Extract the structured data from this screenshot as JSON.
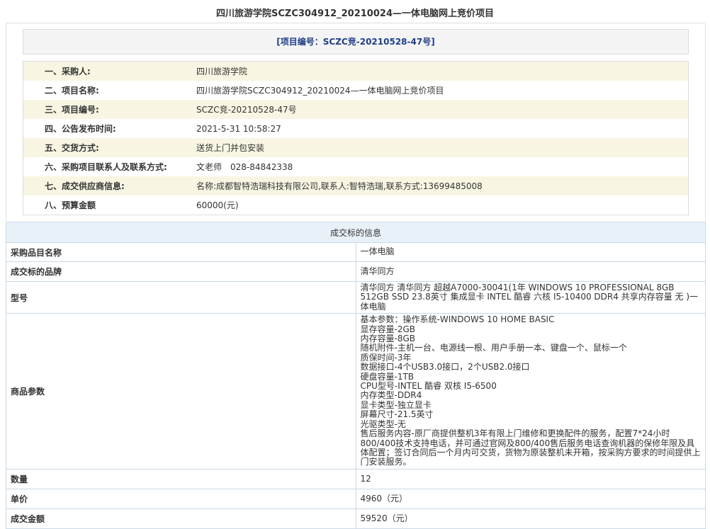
{
  "title": "四川旅游学院SCZC304912_20210024—一体电脑网上竞价项目",
  "project_no_text": "[项目编号：SCZC竞-20210528-47号]",
  "info_rows": [
    {
      "label": "一、采购人:",
      "value": "四川旅游学院"
    },
    {
      "label": "二、项目名称:",
      "value": "四川旅游学院SCZC304912_20210024—一体电脑网上竞价项目"
    },
    {
      "label": "三、项目编号:",
      "value": "SCZC竞-20210528-47号"
    },
    {
      "label": "四、公告发布时间:",
      "value": "2021-5-31 10:58:27"
    },
    {
      "label": "五、交货方式:",
      "value": "送货上门并包安装"
    },
    {
      "label": "六、采购项目联系人及联系方式:",
      "value": "文老师　028-84842338"
    },
    {
      "label": "七、成交供应商信息:",
      "value": "名称:成都智特浩瑞科技有限公司,联系人:智特浩瑞,联系方式:13699485008"
    },
    {
      "label": "八、预算金额",
      "value": "60000(元)"
    }
  ],
  "deal": {
    "header": "成交标的信息",
    "item_name_label": "采购品目名称",
    "item_name": "一体电脑",
    "brand_label": "成交标的品牌",
    "brand": "清华同方",
    "model_label": "型号",
    "model": "清华同方 清华同方 超越A7000-30041(1年 WINDOWS 10 PROFESSIONAL 8GB 512GB SSD 23.8英寸 集成显卡 INTEL 酷睿 六核 I5-10400 DDR4 共享内存容量 无 )一体电脑",
    "params_label": "商品参数",
    "params": [
      "基本参数：操作系统-WINDOWS 10 HOME BASIC",
      "显存容量-2GB",
      "内存容量-8GB",
      "随机附件-主机一台、电源线一根、用户手册一本、键盘一个、鼠标一个",
      "质保时间-3年",
      "数据接口-4个USB3.0接口，2个USB2.0接口",
      "硬盘容量-1TB",
      "CPU型号-INTEL 酷睿 双核 I5-6500",
      "内存类型-DDR4",
      "显卡类型-独立显卡",
      "屏幕尺寸-21.5英寸",
      "光驱类型-无",
      "售后服务内容-原厂商提供整机3年有限上门维修和更换配件的服务，配置7*24小时800/400技术支持电话，并可通过官网及800/400售后服务电话查询机器的保修年限及具体配置；签订合同后一个月内可交货，货物为原装整机未开箱，按采购方要求的时间提供上门安装服务。"
    ],
    "qty_label": "数量",
    "qty": "12",
    "unit_price_label": "单价",
    "unit_price": "4960（元）",
    "total_label": "成交金额",
    "total": "59520（元）"
  }
}
